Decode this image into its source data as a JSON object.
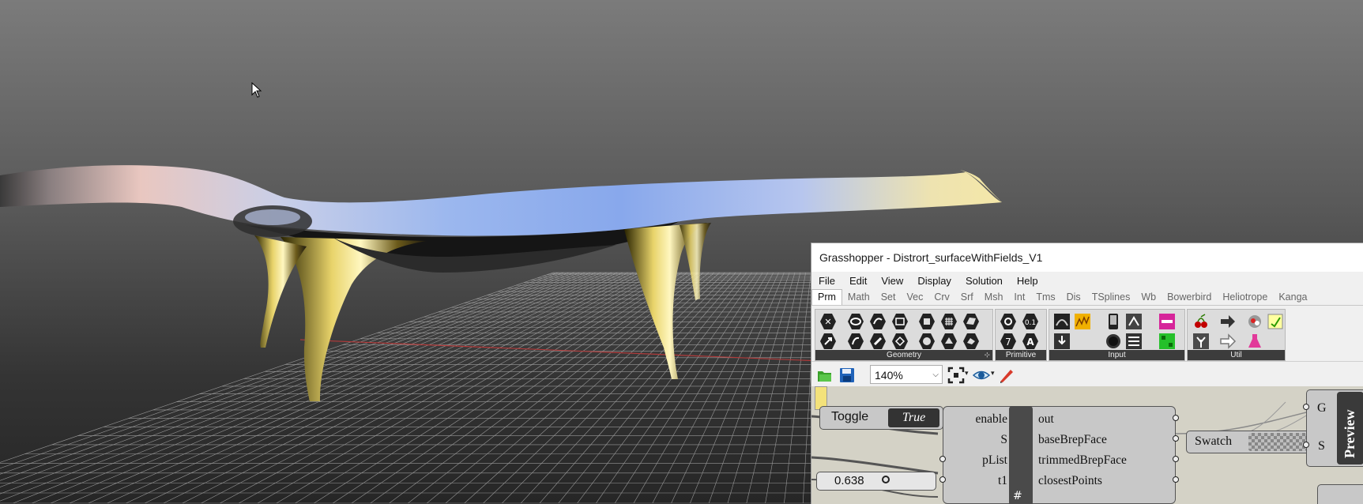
{
  "viewport": {
    "background_top": "#7b7b7b",
    "background_bottom": "#262626",
    "grid_color": "#bdbdbd",
    "axis_color": "#b03a3a"
  },
  "grasshopper": {
    "title": "Grasshopper - Distrort_surfaceWithFields_V1",
    "menu": [
      "File",
      "Edit",
      "View",
      "Display",
      "Solution",
      "Help"
    ],
    "tabs": [
      "Prm",
      "Math",
      "Set",
      "Vec",
      "Crv",
      "Srf",
      "Msh",
      "Int",
      "Tms",
      "Dis",
      "TSplines",
      "Wb",
      "Bowerbird",
      "Heliotrope",
      "Kanga"
    ],
    "active_tab": "Prm",
    "panels": {
      "geometry": "Geometry",
      "primitive": "Primitive",
      "input": "Input",
      "util": "Util"
    },
    "toolbar": {
      "zoom": "140%"
    },
    "canvas": {
      "toggle": {
        "label": "Toggle",
        "value": "True"
      },
      "cluster": {
        "inputs": [
          "enable",
          "S",
          "pList",
          "t1"
        ],
        "outputs": [
          "out",
          "baseBrepFace",
          "trimmedBrepFace",
          "closestPoints"
        ]
      },
      "slider_value": "0.638",
      "swatch_label": "Swatch",
      "preview": {
        "label": "Preview",
        "inputs": [
          "G",
          "S"
        ]
      }
    }
  }
}
